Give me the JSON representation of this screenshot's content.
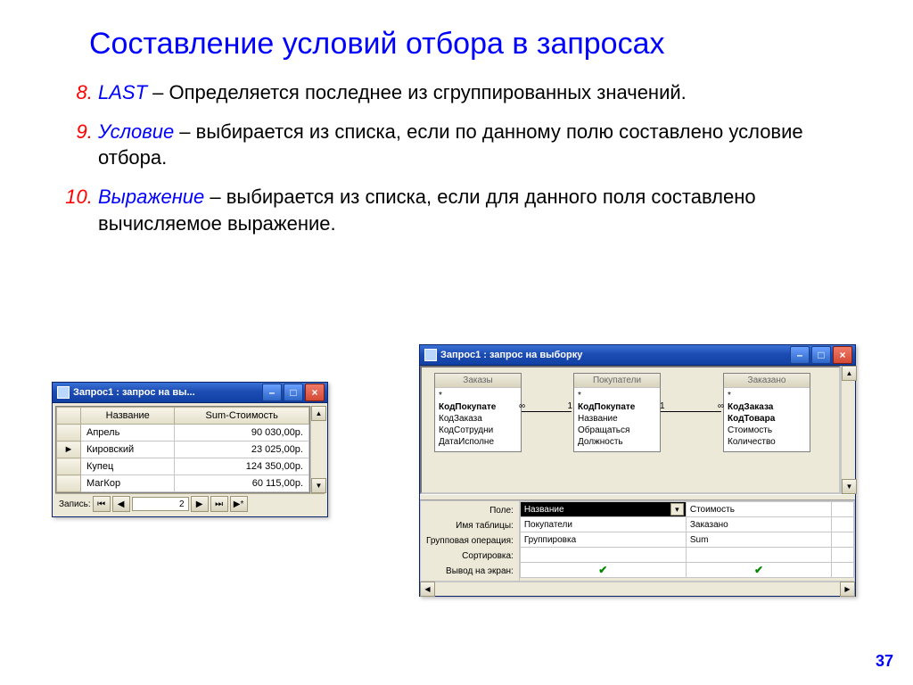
{
  "title": "Составление условий отбора в запросах",
  "page_number": "37",
  "list_start": 8,
  "items": [
    {
      "term": "LAST",
      "body": "–  Определяется последнее из сгруппированных значений."
    },
    {
      "term": "Условие",
      "body": "– выбирается из списка, если по данному полю составлено условие отбора."
    },
    {
      "term": "Выражение",
      "body": " – выбирается из списка, если для данного поля составлено вычисляемое выражение."
    }
  ],
  "left_window": {
    "title": "Запрос1 : запрос на вы...",
    "columns": [
      "Название",
      "Sum-Стоимость"
    ],
    "rows": [
      {
        "name": "Апрель",
        "sum": "90 030,00р."
      },
      {
        "name": "Кировский",
        "sum": "23 025,00р."
      },
      {
        "name": "Купец",
        "sum": "124 350,00р."
      },
      {
        "name": "МагКор",
        "sum": "60 115,00р."
      }
    ],
    "selected_row_index": 1,
    "record_label": "Запись:",
    "record_value": "2"
  },
  "right_window": {
    "title": "Запрос1 : запрос на выборку",
    "tables": [
      {
        "name": "Заказы",
        "fields": [
          "*",
          "КодПокупате",
          "КодЗаказа",
          "КодСотрудни",
          "ДатаИсполне"
        ],
        "bold": [
          1
        ]
      },
      {
        "name": "Покупатели",
        "fields": [
          "*",
          "КодПокупате",
          "Название",
          "Обращаться",
          "Должность"
        ],
        "bold": [
          1
        ]
      },
      {
        "name": "Заказано",
        "fields": [
          "*",
          "КодЗаказа",
          "КодТовара",
          "Стоимость",
          "Количество"
        ],
        "bold": [
          1,
          2
        ]
      }
    ],
    "qbe_labels": [
      "Поле:",
      "Имя таблицы:",
      "Групповая операция:",
      "Сортировка:",
      "Вывод на экран:"
    ],
    "qbe_grid": [
      {
        "field": "Название",
        "table": "Покупатели",
        "group": "Группировка",
        "sort": "",
        "show": true,
        "selected": true
      },
      {
        "field": "Стоимость",
        "table": "Заказано",
        "group": "Sum",
        "sort": "",
        "show": true,
        "selected": false
      },
      {
        "field": "",
        "table": "",
        "group": "",
        "sort": "",
        "show": false,
        "selected": false
      }
    ]
  }
}
